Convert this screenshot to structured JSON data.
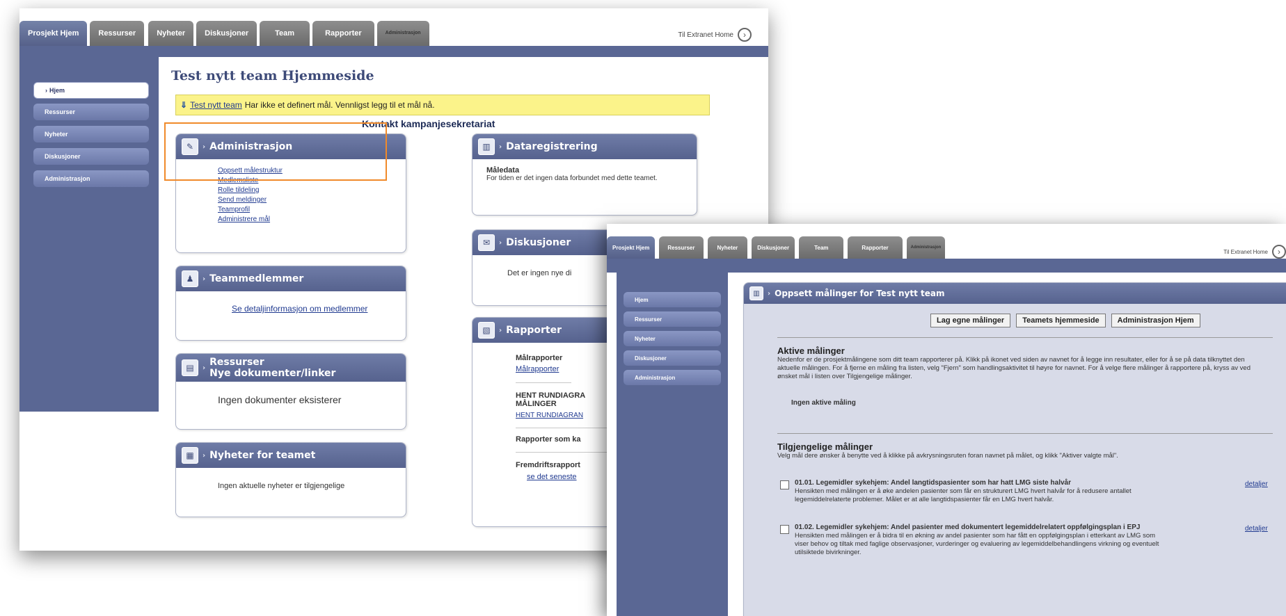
{
  "shot1": {
    "tabs": [
      "Prosjekt Hjem",
      "Ressurser",
      "Nyheter",
      "Diskusjoner",
      "Team",
      "Rapporter",
      "Administrasjon"
    ],
    "extranet_link": "Til Extranet Home",
    "sidebar": [
      "Hjem",
      "Ressurser",
      "Nyheter",
      "Diskusjoner",
      "Administrasjon"
    ],
    "title": "Test nytt team Hjemmeside",
    "notice": {
      "link": "Test nytt team",
      "text": "Har ikke et definert mål. Vennligst legg til et mål nå."
    },
    "contact": "Kontakt kampanjesekretariat",
    "admin": {
      "title": "Administrasjon",
      "links": [
        "Oppsett målestruktur",
        "Medlemsliste",
        "Rolle tildeling",
        "Send meldinger",
        "Teamprofil",
        "Administrere mål"
      ]
    },
    "teammedlemmer": {
      "title": "Teammedlemmer",
      "link": "Se detaljinformasjon om medlemmer"
    },
    "ressurser": {
      "title": "Ressurser",
      "subtitle": "Nye dokumenter/linker",
      "text": "Ingen dokumenter eksisterer"
    },
    "nyheter": {
      "title": "Nyheter for teamet",
      "text": "Ingen aktuelle nyheter er tilgjengelige"
    },
    "dataregistrering": {
      "title": "Dataregistrering",
      "subtitle": "Måledata",
      "text": "For tiden er det ingen data forbundet med dette teamet."
    },
    "diskusjoner": {
      "title": "Diskusjoner",
      "text": "Det er ingen nye di"
    },
    "rapporter": {
      "title": "Rapporter",
      "malrapporter_label": "Målrapporter",
      "malrapporter_link": "Målrapporter",
      "hent_label": "HENT RUNDIAGRA MÅLINGER",
      "hent_link": "HENT RUNDIAGRAN",
      "rapporter_som": "Rapporter som ka",
      "fremdrift": "Fremdriftsrapport",
      "se_siste": "se det seneste"
    }
  },
  "shot2": {
    "tabs": [
      "Prosjekt Hjem",
      "Ressurser",
      "Nyheter",
      "Diskusjoner",
      "Team",
      "Rapporter",
      "Administrasjon"
    ],
    "extranet_link": "Til Extranet Home",
    "sidebar": [
      "Hjem",
      "Ressurser",
      "Nyheter",
      "Diskusjoner",
      "Administrasjon"
    ],
    "panel_title": "Oppsett målinger for Test nytt team",
    "buttons": [
      "Lag egne målinger",
      "Teamets hjemmeside",
      "Administrasjon Hjem"
    ],
    "aktive": {
      "title": "Aktive målinger",
      "desc": "Nedenfor er de prosjektmålingene som ditt team rapporterer på. Klikk på ikonet ved siden av navnet for å legge inn resultater, eller for å se på data tilknyttet den aktuelle målingen. For å fjerne en måling fra listen, velg \"Fjern\" som handlingsaktivitet til høyre for navnet. For å velge flere målinger å rapportere på, kryss av ved ønsket mål i listen over Tilgjengelige målinger.",
      "none": "Ingen aktive måling"
    },
    "tilgjengelige": {
      "title": "Tilgjengelige målinger",
      "desc": "Velg mål dere ønsker å benytte ved å klikke på avkrysningsruten foran navnet på målet, og klikk \"Aktiver valgte mål\".",
      "items": [
        {
          "title": "01.01. Legemidler sykehjem: Andel langtidspasienter som har hatt LMG siste halvår",
          "desc": "Hensikten med målingen er å øke andelen pasienter som får en strukturert LMG hvert halvår for å redusere antallet legemiddelrelaterte problemer. Målet er at alle langtidspasienter får en LMG hvert halvår.",
          "link": "detaljer"
        },
        {
          "title": "01.02. Legemidler sykehjem: Andel pasienter med dokumentert legemiddelrelatert oppfølgingsplan i EPJ",
          "desc": "Hensikten med målingen er å bidra til en økning av andel pasienter som har fått en oppfølgingsplan i etterkant av LMG som viser behov og tiltak med faglige observasjoner, vurderinger og evaluering av legemiddelbehandlingens virkning og eventuelt utilsiktede bivirkninger.",
          "link": "detaljer"
        }
      ]
    }
  }
}
